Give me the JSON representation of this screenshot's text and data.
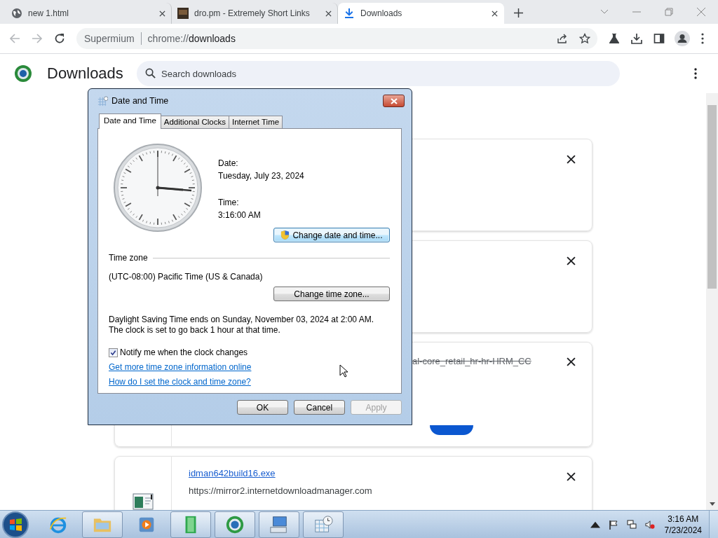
{
  "browser": {
    "tabs": [
      {
        "title": "new 1.html",
        "kind": "globe",
        "selected": false
      },
      {
        "title": "dro.pm - Extremely Short Links",
        "kind": "thumb",
        "selected": false
      },
      {
        "title": "Downloads",
        "kind": "download",
        "selected": true
      }
    ],
    "nav_buttons": [
      {
        "kind": "back",
        "disabled": true
      },
      {
        "kind": "forward",
        "disabled": true
      },
      {
        "kind": "reload",
        "disabled": false
      }
    ],
    "address": {
      "chip": "Supermium",
      "scheme": "chrome://",
      "path": "downloads"
    }
  },
  "page": {
    "title": "Downloads",
    "search": {
      "placeholder": "Search downloads"
    },
    "items": [
      {
        "kind": "covered"
      },
      {
        "kind": "covered"
      },
      {
        "kind": "removed",
        "name": "al-core_retail_hr-hr-HRM_CC"
      },
      {
        "kind": "file",
        "name": "idman642build16.exe",
        "url": "https://mirror2.internetdownloadmanager.com"
      }
    ]
  },
  "dialog": {
    "title": "Date and Time",
    "tabs": [
      {
        "label": "Date and Time",
        "selected": true
      },
      {
        "label": "Additional Clocks",
        "selected": false
      },
      {
        "label": "Internet Time",
        "selected": false
      }
    ],
    "date_label": "Date:",
    "date": "Tuesday, July 23, 2024",
    "time_label": "Time:",
    "time": "3:16:00 AM",
    "change_datetime": {
      "label": "Change date and time...",
      "highlighted": true
    },
    "timezone_heading": "Time zone",
    "timezone": "(UTC-08:00) Pacific Time (US & Canada)",
    "change_timezone": {
      "label": "Change time zone...",
      "highlighted": false
    },
    "dst_note": "Daylight Saving Time ends on Sunday, November 03, 2024 at 2:00 AM. The clock is set to go back 1 hour at that time.",
    "notify": {
      "label": "Notify me when the clock changes",
      "checked": true
    },
    "links": [
      "Get more time zone information online",
      "How do I set the clock and time zone?"
    ],
    "buttons": [
      {
        "label": "OK",
        "disabled": false
      },
      {
        "label": "Cancel",
        "disabled": false
      },
      {
        "label": "Apply",
        "disabled": true
      }
    ]
  },
  "taskbar": {
    "apps": [
      {
        "kind": "ie",
        "running": false
      },
      {
        "kind": "folder",
        "running": true
      },
      {
        "kind": "media",
        "running": false
      },
      {
        "kind": "green",
        "running": true
      },
      {
        "kind": "chrome",
        "running": true
      },
      {
        "kind": "keyboard",
        "running": true
      },
      {
        "kind": "calendar",
        "running": true
      }
    ],
    "volume_muted": true,
    "time": "3:16 AM",
    "date": "7/23/2024"
  }
}
